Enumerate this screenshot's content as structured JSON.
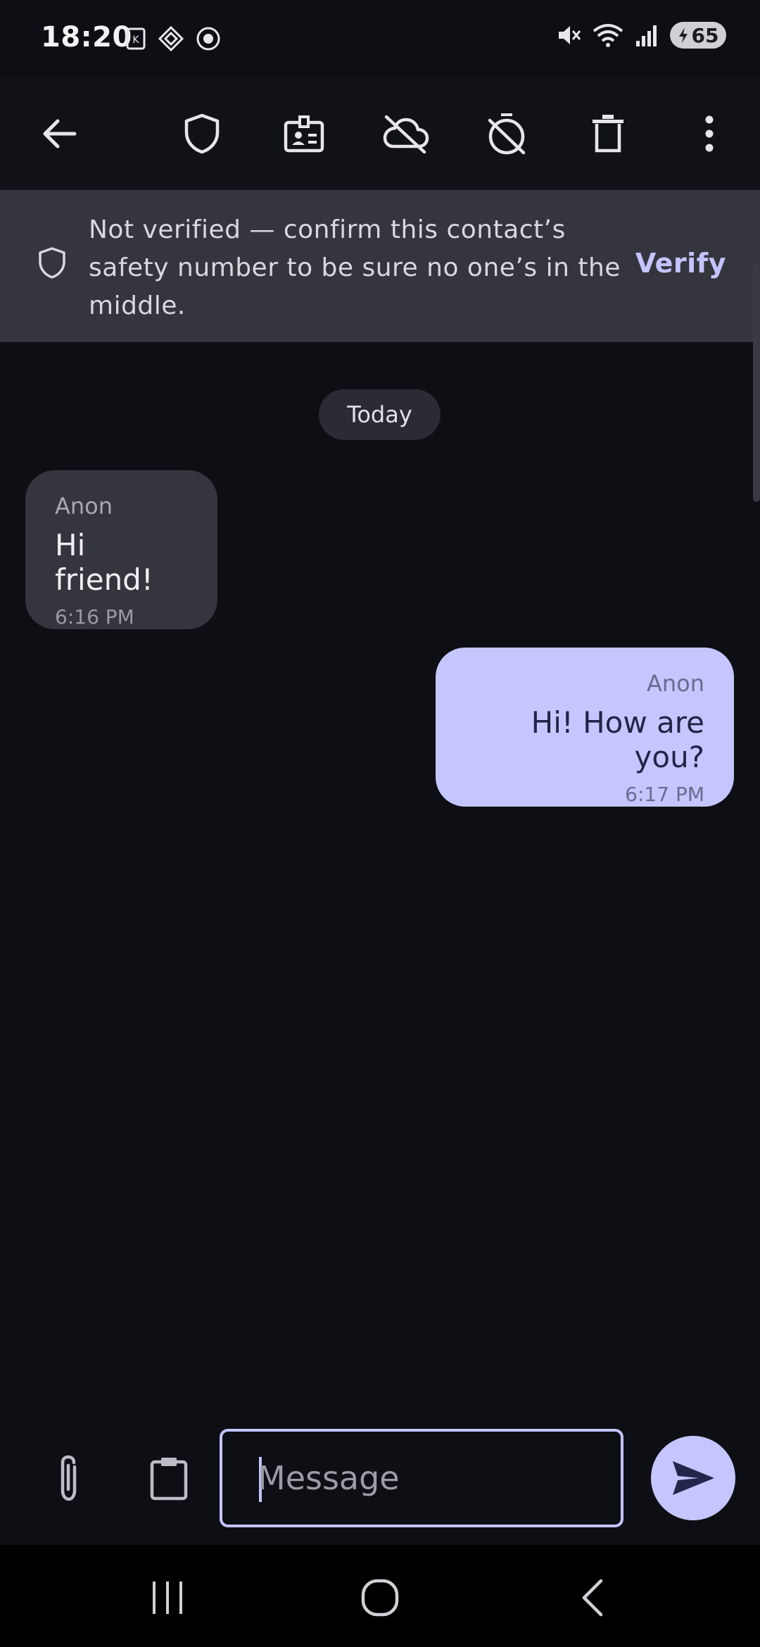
{
  "status_bar": {
    "time": "18:20",
    "battery_level": "65",
    "left_icons": [
      "k-app-icon",
      "diamond-app-icon",
      "face-app-icon"
    ],
    "right_icons": [
      "mute-icon",
      "wifi-icon",
      "signal-icon",
      "battery-charging-icon"
    ]
  },
  "toolbar": {
    "icons": [
      "back-arrow-icon",
      "shield-icon",
      "contact-card-icon",
      "cloud-off-icon",
      "timer-off-icon",
      "trash-icon",
      "more-vert-icon"
    ]
  },
  "banner": {
    "text": "Not verified — confirm this contact’s safety number to be sure no one’s in the middle.",
    "action": "Verify"
  },
  "chat": {
    "date_chip": "Today",
    "messages": [
      {
        "sender": "Anon",
        "text": "Hi friend!",
        "time": "6:16 PM",
        "direction": "incoming"
      },
      {
        "sender": "Anon",
        "text": "Hi! How are you?",
        "time": "6:17 PM",
        "direction": "outgoing"
      }
    ]
  },
  "composer": {
    "placeholder": "Message",
    "value": ""
  },
  "colors": {
    "background": "#0e0f14",
    "banner": "#35353d",
    "accent": "#c3c4ff",
    "outgoing_bubble": "#c5c6ff",
    "incoming_bubble": "#35353d"
  }
}
